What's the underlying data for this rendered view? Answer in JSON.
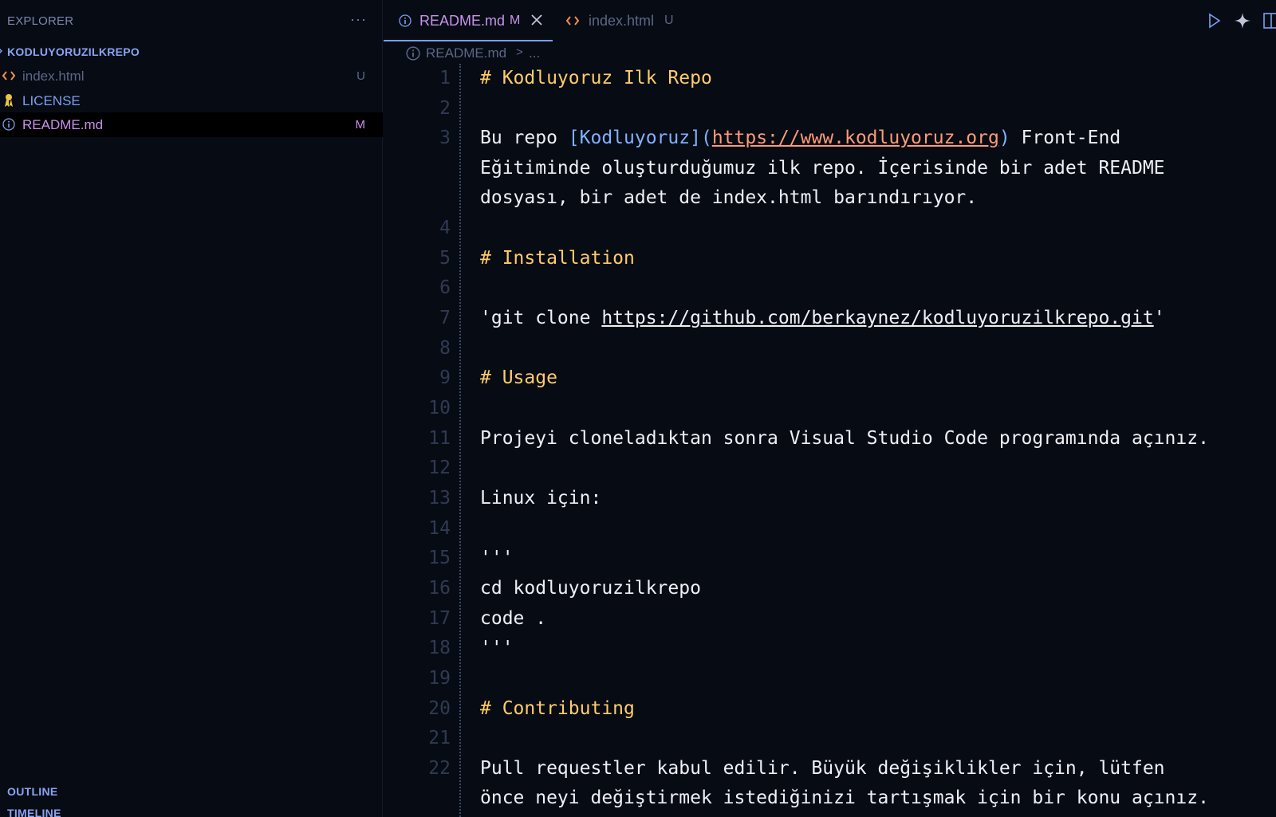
{
  "sidebar": {
    "title": "EXPLORER",
    "more": "···",
    "root": "KODLUYORUZILKREPO",
    "files": [
      {
        "name": "index.html",
        "badge": "U",
        "icon": "html-file-icon",
        "color": "#5c6787",
        "badge_color": "#5c6787"
      },
      {
        "name": "LICENSE",
        "badge": "",
        "icon": "license-icon",
        "color": "#7aa0f0",
        "badge_color": "#7aa0f0"
      },
      {
        "name": "README.md",
        "badge": "M",
        "icon": "info-icon",
        "color": "#c792ea",
        "badge_color": "#c792ea"
      }
    ],
    "outline": "OUTLINE",
    "timeline": "TIMELINE"
  },
  "tabs": [
    {
      "label": "README.md",
      "badge": "M",
      "icon": "info-icon",
      "active": true,
      "color": "#c792ea"
    },
    {
      "label": "index.html",
      "badge": "U",
      "icon": "html-file-icon",
      "active": false,
      "color": "#5c6787"
    }
  ],
  "breadcrumb": {
    "file": "README.md",
    "separator": ">",
    "more": "..."
  },
  "editor": {
    "line_numbers": [
      "1",
      "2",
      "3",
      "",
      "",
      "4",
      "5",
      "6",
      "7",
      "8",
      "9",
      "10",
      "11",
      "12",
      "13",
      "14",
      "15",
      "16",
      "17",
      "18",
      "19",
      "20",
      "21",
      "22",
      ""
    ],
    "lines": {
      "l1": "# Kodluyoruz Ilk Repo",
      "l3a_pre": "Bu repo ",
      "l3a_linktext": "[Kodluyoruz]",
      "l3a_paren_open": "(",
      "l3a_url": "https://www.kodluyoruz.org",
      "l3a_paren_close": ")",
      "l3a_post": " Front-End",
      "l3b": "Eğitiminde oluşturduğumuz ilk repo. İçerisinde bir adet README",
      "l3c": "dosyası, bir adet de index.html barındırıyor.",
      "l5": "# Installation",
      "l7_pre": "'git clone ",
      "l7_url": "https://github.com/berkaynez/kodluyoruzilkrepo.git",
      "l7_post": "'",
      "l9": "# Usage",
      "l11": "Projeyi cloneladıktan sonra Visual Studio Code programında açınız.",
      "l13": "Linux için:",
      "l15": "'''",
      "l16": "cd kodluyoruzilkrepo",
      "l17": "code .",
      "l18": "'''",
      "l20": "# Contributing",
      "l22a": "Pull requestler kabul edilir. Büyük değişiklikler için, lütfen",
      "l22b": "önce neyi değiştirmek istediğinizi tartışmak için bir konu açınız."
    }
  },
  "colors": {
    "heading": "#ffcc6b",
    "link_text": "#7eb1ff",
    "link_url": "#ff9a76",
    "accent": "#7aa0f0"
  }
}
